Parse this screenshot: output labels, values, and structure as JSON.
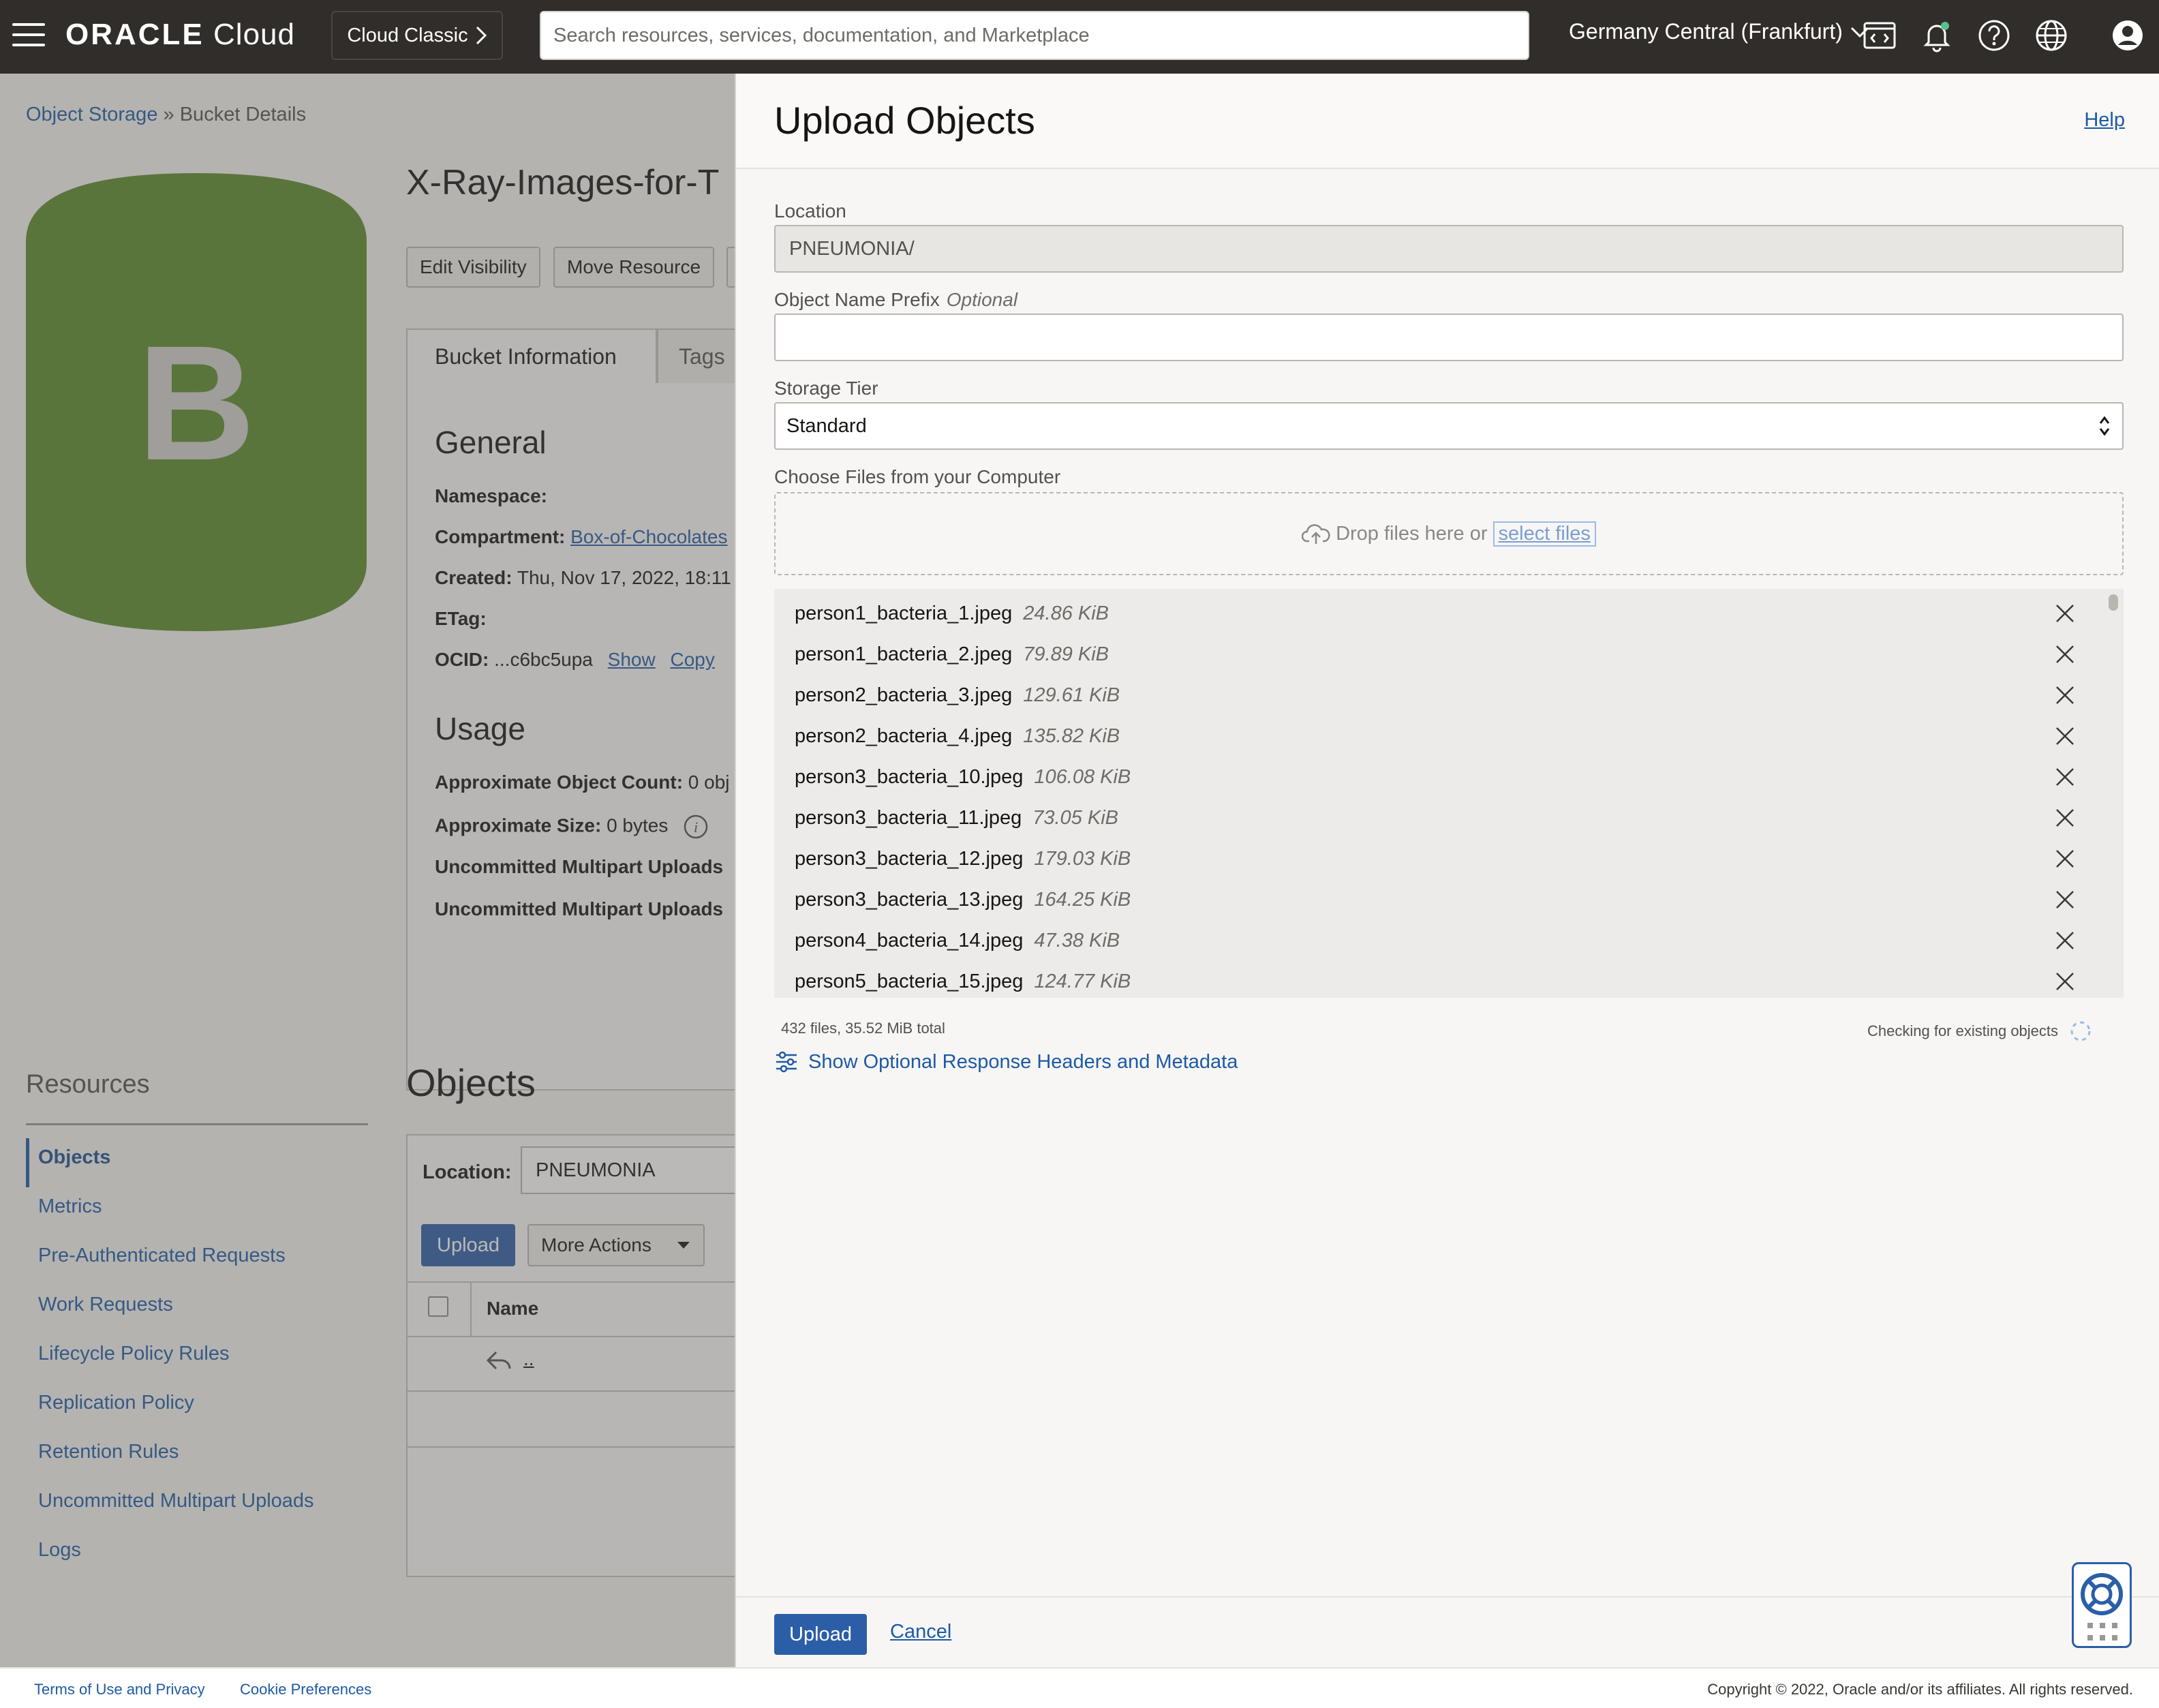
{
  "topbar": {
    "logo_brand": "ORACLE",
    "logo_product": "Cloud",
    "cloud_classic": "Cloud Classic",
    "search_placeholder": "Search resources, services, documentation, and Marketplace",
    "region": "Germany Central (Frankfurt)"
  },
  "page": {
    "breadcrumb_root": "Object Storage",
    "breadcrumb_sep": "»",
    "breadcrumb_current": "Bucket Details",
    "bucket_letter": "B",
    "bucket_title": "X-Ray-Images-for-T",
    "buttons": {
      "edit_visibility": "Edit Visibility",
      "move_resource": "Move Resource"
    },
    "tabs": {
      "bucket_information": "Bucket Information",
      "tags": "Tags"
    },
    "general": {
      "heading": "General",
      "namespace_label": "Namespace:",
      "compartment_label": "Compartment:",
      "compartment_value": "Box-of-Chocolates",
      "created_label": "Created:",
      "created_value": "Thu, Nov 17, 2022, 18:11",
      "etag_label": "ETag:",
      "ocid_label": "OCID:",
      "ocid_value": "...c6bc5upa",
      "show": "Show",
      "copy": "Copy"
    },
    "usage": {
      "heading": "Usage",
      "object_count_label": "Approximate Object Count:",
      "object_count_value": "0 obj",
      "size_label": "Approximate Size:",
      "size_value": "0 bytes",
      "multipart1": "Uncommitted Multipart Uploads",
      "multipart2": "Uncommitted Multipart Uploads"
    },
    "resources": {
      "heading": "Resources",
      "items": [
        "Objects",
        "Metrics",
        "Pre-Authenticated Requests",
        "Work Requests",
        "Lifecycle Policy Rules",
        "Replication Policy",
        "Retention Rules",
        "Uncommitted Multipart Uploads",
        "Logs"
      ]
    },
    "objects": {
      "heading": "Objects",
      "location_label": "Location:",
      "location_value": "PNEUMONIA",
      "upload": "Upload",
      "more_actions": "More Actions",
      "name_col": "Name",
      "parent_link": ".."
    }
  },
  "panel": {
    "title": "Upload Objects",
    "help": "Help",
    "location_label": "Location",
    "location_value": "PNEUMONIA/",
    "prefix_label": "Object Name Prefix",
    "prefix_optional": "Optional",
    "prefix_value": "",
    "tier_label": "Storage Tier",
    "tier_value": "Standard",
    "choose_label": "Choose Files from your Computer",
    "drop_text": "Drop files here or",
    "select_files": "select files",
    "files": [
      {
        "name": "person1_bacteria_1.jpeg",
        "size": "24.86 KiB"
      },
      {
        "name": "person1_bacteria_2.jpeg",
        "size": "79.89 KiB"
      },
      {
        "name": "person2_bacteria_3.jpeg",
        "size": "129.61 KiB"
      },
      {
        "name": "person2_bacteria_4.jpeg",
        "size": "135.82 KiB"
      },
      {
        "name": "person3_bacteria_10.jpeg",
        "size": "106.08 KiB"
      },
      {
        "name": "person3_bacteria_11.jpeg",
        "size": "73.05 KiB"
      },
      {
        "name": "person3_bacteria_12.jpeg",
        "size": "179.03 KiB"
      },
      {
        "name": "person3_bacteria_13.jpeg",
        "size": "164.25 KiB"
      },
      {
        "name": "person4_bacteria_14.jpeg",
        "size": "47.38 KiB"
      },
      {
        "name": "person5_bacteria_15.jpeg",
        "size": "124.77 KiB"
      }
    ],
    "files_summary": "432 files, 35.52 MiB total",
    "checking_status": "Checking for existing objects",
    "optional_headers": "Show Optional Response Headers and Metadata",
    "upload_button": "Upload",
    "cancel": "Cancel"
  },
  "footer": {
    "terms": "Terms of Use and Privacy",
    "cookies": "Cookie Preferences",
    "copyright": "Copyright © 2022, Oracle and/or its affiliates. All rights reserved."
  },
  "colors": {
    "accent": "#2b5ea7",
    "topbar": "#312d2a",
    "bucket_green": "#5b8a2a"
  }
}
